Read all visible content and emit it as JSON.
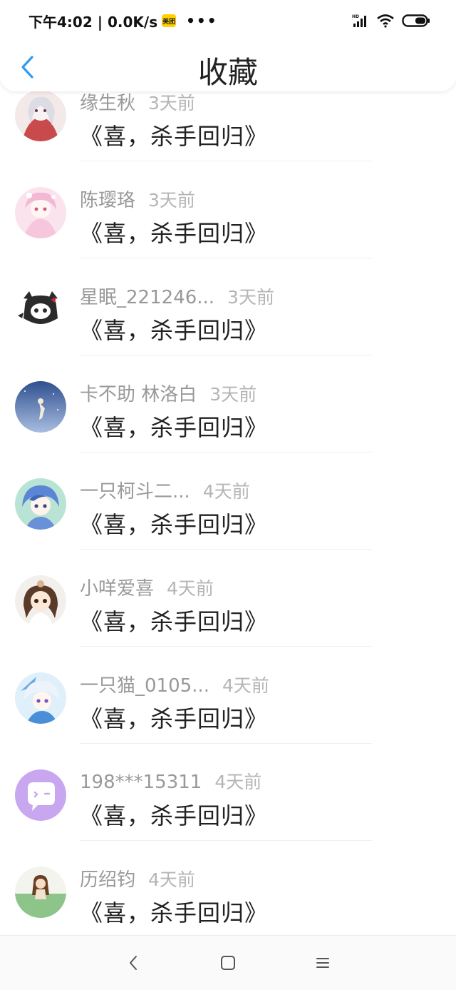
{
  "status_bar": {
    "time_speed": "下午4:02 | 0.0K/s",
    "app_badge": "美团",
    "more": "•••"
  },
  "header": {
    "title": "收藏"
  },
  "items": [
    {
      "name": "缘生秋",
      "time": "3天前",
      "title": "《喜，杀手回归》",
      "avatar_color": "#c84a4a"
    },
    {
      "name": "陈璎珞",
      "time": "3天前",
      "title": "《喜，杀手回归》",
      "avatar_color": "#f2b8d4"
    },
    {
      "name": "星眠_221246...",
      "time": "3天前",
      "title": "《喜，杀手回归》",
      "avatar_color": "#2b2b2b"
    },
    {
      "name": "卡不助 林洛白",
      "time": "3天前",
      "title": "《喜，杀手回归》",
      "avatar_color": "#4b6aa8"
    },
    {
      "name": "一只柯斗二...",
      "time": "4天前",
      "title": "《喜，杀手回归》",
      "avatar_color": "#5b86d6"
    },
    {
      "name": "小咩爱喜",
      "time": "4天前",
      "title": "《喜，杀手回归》",
      "avatar_color": "#d9b38c"
    },
    {
      "name": "一只猫_0105...",
      "time": "4天前",
      "title": "《喜，杀手回归》",
      "avatar_color": "#6fa9e6"
    },
    {
      "name": "198***15311",
      "time": "4天前",
      "title": "《喜，杀手回归》",
      "avatar_color": "#c9a7f0"
    },
    {
      "name": "历绍钧",
      "time": "4天前",
      "title": "《喜，杀手回归》",
      "avatar_color": "#8cc48a"
    }
  ],
  "colors": {
    "accent": "#2f9bf0",
    "name_gray": "#999999",
    "title_black": "#222222"
  }
}
